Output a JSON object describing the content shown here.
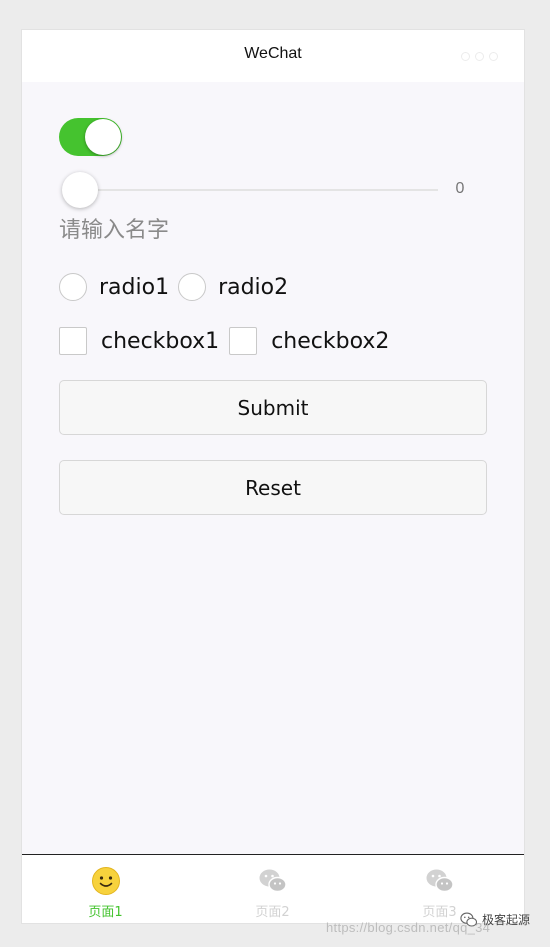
{
  "navbar": {
    "title": "WeChat",
    "menu_icon": "more-dots-icon"
  },
  "switch": {
    "checked": true,
    "color": "#45c32f"
  },
  "slider": {
    "value": "0",
    "value_fraction": 0
  },
  "name_input": {
    "placeholder": "请输入名字",
    "value": ""
  },
  "radios": [
    {
      "label": "radio1",
      "checked": false
    },
    {
      "label": "radio2",
      "checked": false
    }
  ],
  "checkboxes": [
    {
      "label": "checkbox1",
      "checked": false
    },
    {
      "label": "checkbox2",
      "checked": false
    }
  ],
  "buttons": {
    "submit_label": "Submit",
    "reset_label": "Reset"
  },
  "tabbar": {
    "tabs": [
      {
        "label": "页面1",
        "icon": "smiley-face-icon",
        "active": true
      },
      {
        "label": "页面2",
        "icon": "wechat-icon",
        "active": false
      },
      {
        "label": "页面3",
        "icon": "wechat-icon",
        "active": false
      }
    ],
    "active_color": "#45c32f",
    "inactive_color": "#d2d2d2"
  },
  "watermark": {
    "url": "https://blog.csdn.net/qq_34",
    "brand": "极客起源",
    "icon": "wechat-icon"
  }
}
